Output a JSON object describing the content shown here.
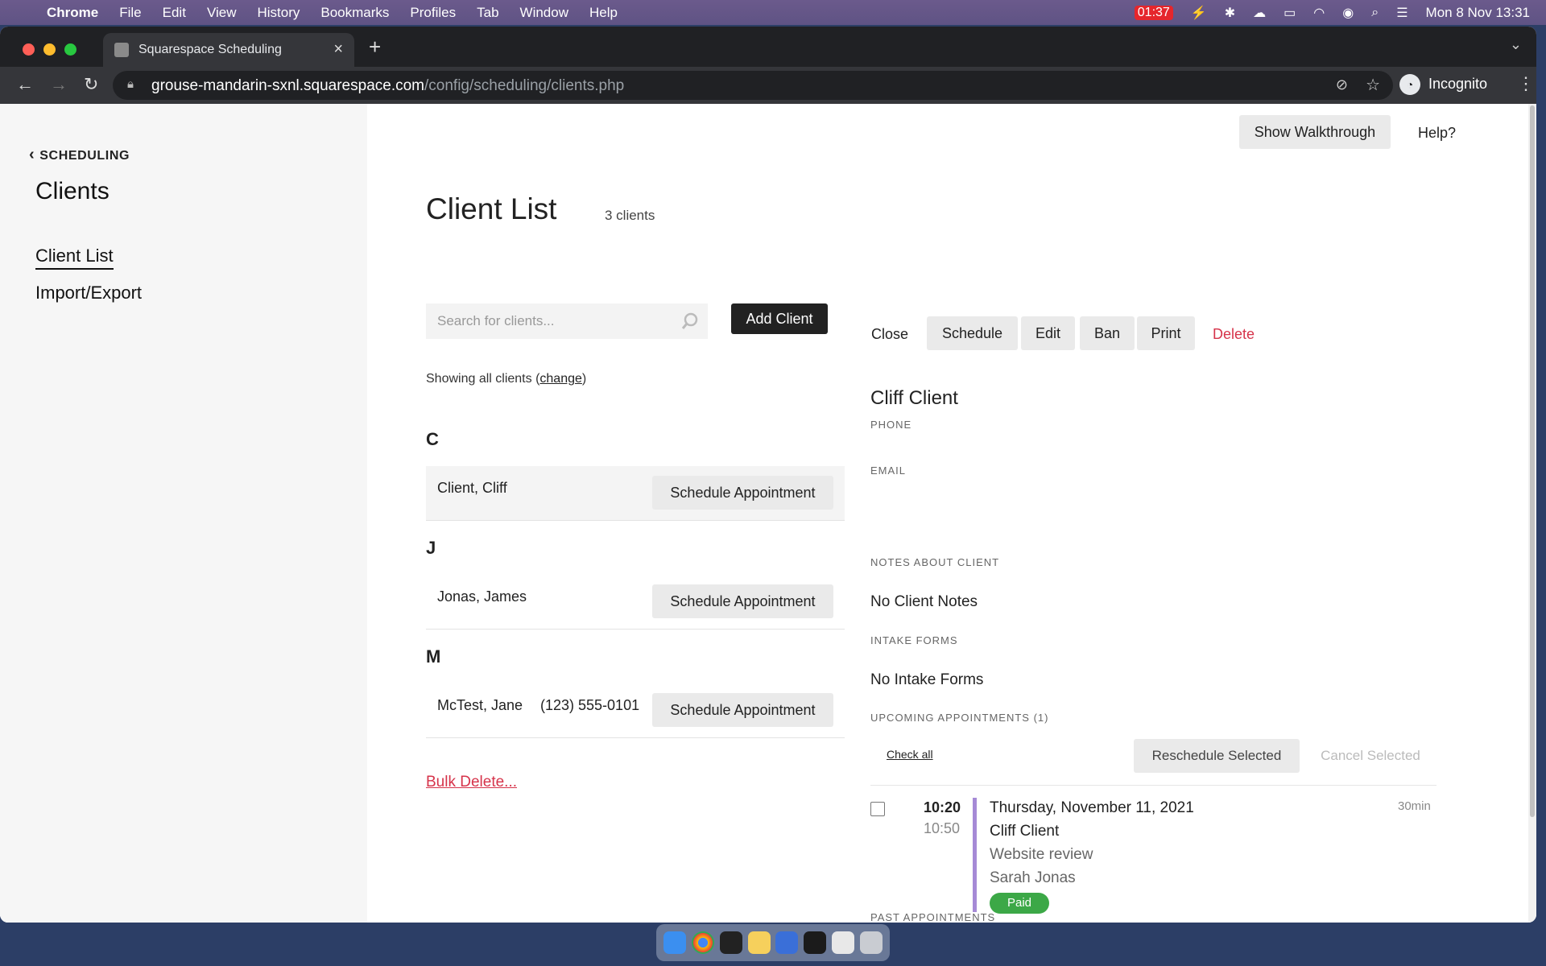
{
  "menubar": {
    "app": "Chrome",
    "items": [
      "File",
      "Edit",
      "View",
      "History",
      "Bookmarks",
      "Profiles",
      "Tab",
      "Window",
      "Help"
    ],
    "battery_badge": "01:37",
    "clock": "Mon 8 Nov  13:31"
  },
  "browser": {
    "tab_title": "Squarespace Scheduling",
    "url_host": "grouse-mandarin-sxnl.squarespace.com",
    "url_path": "/config/scheduling/clients.php",
    "profile": "Incognito"
  },
  "sidebar": {
    "back_label": "SCHEDULING",
    "title": "Clients",
    "items": [
      {
        "label": "Client List",
        "active": true
      },
      {
        "label": "Import/Export",
        "active": false
      }
    ]
  },
  "top": {
    "walkthrough": "Show Walkthrough",
    "help": "Help?"
  },
  "list": {
    "title": "Client List",
    "count": "3 clients",
    "search_placeholder": "Search for clients...",
    "add_client": "Add Client",
    "showing_prefix": "Showing all clients (",
    "showing_link": "change",
    "showing_suffix": ")",
    "groups": [
      {
        "letter": "C",
        "name": "Client, Cliff",
        "phone": "",
        "action": "Schedule Appointment"
      },
      {
        "letter": "J",
        "name": "Jonas, James",
        "phone": "",
        "action": "Schedule Appointment"
      },
      {
        "letter": "M",
        "name": "McTest, Jane",
        "phone": "(123) 555-0101",
        "action": "Schedule Appointment"
      }
    ],
    "bulk_delete": "Bulk Delete..."
  },
  "detail": {
    "actions": {
      "close": "Close",
      "schedule": "Schedule",
      "edit": "Edit",
      "ban": "Ban",
      "print": "Print",
      "delete": "Delete"
    },
    "name": "Cliff Client",
    "phone_label": "PHONE",
    "email_label": "EMAIL",
    "notes_label": "NOTES ABOUT CLIENT",
    "notes_value": "No Client Notes",
    "intake_label": "INTAKE FORMS",
    "intake_value": "No Intake Forms",
    "upcoming_label": "UPCOMING APPOINTMENTS (1)",
    "check_all": "Check all",
    "reschedule": "Reschedule Selected",
    "cancel": "Cancel Selected",
    "appointment": {
      "start": "10:20",
      "end": "10:50",
      "date": "Thursday, November 11, 2021",
      "client": "Cliff Client",
      "service": "Website review",
      "staff": "Sarah Jonas",
      "duration": "30min",
      "status": "Paid"
    },
    "past_label": "PAST APPOINTMENTS"
  },
  "colors": {
    "accent_red": "#d6334a",
    "paid_green": "#3ca847",
    "appt_bar": "#a68ad6"
  }
}
